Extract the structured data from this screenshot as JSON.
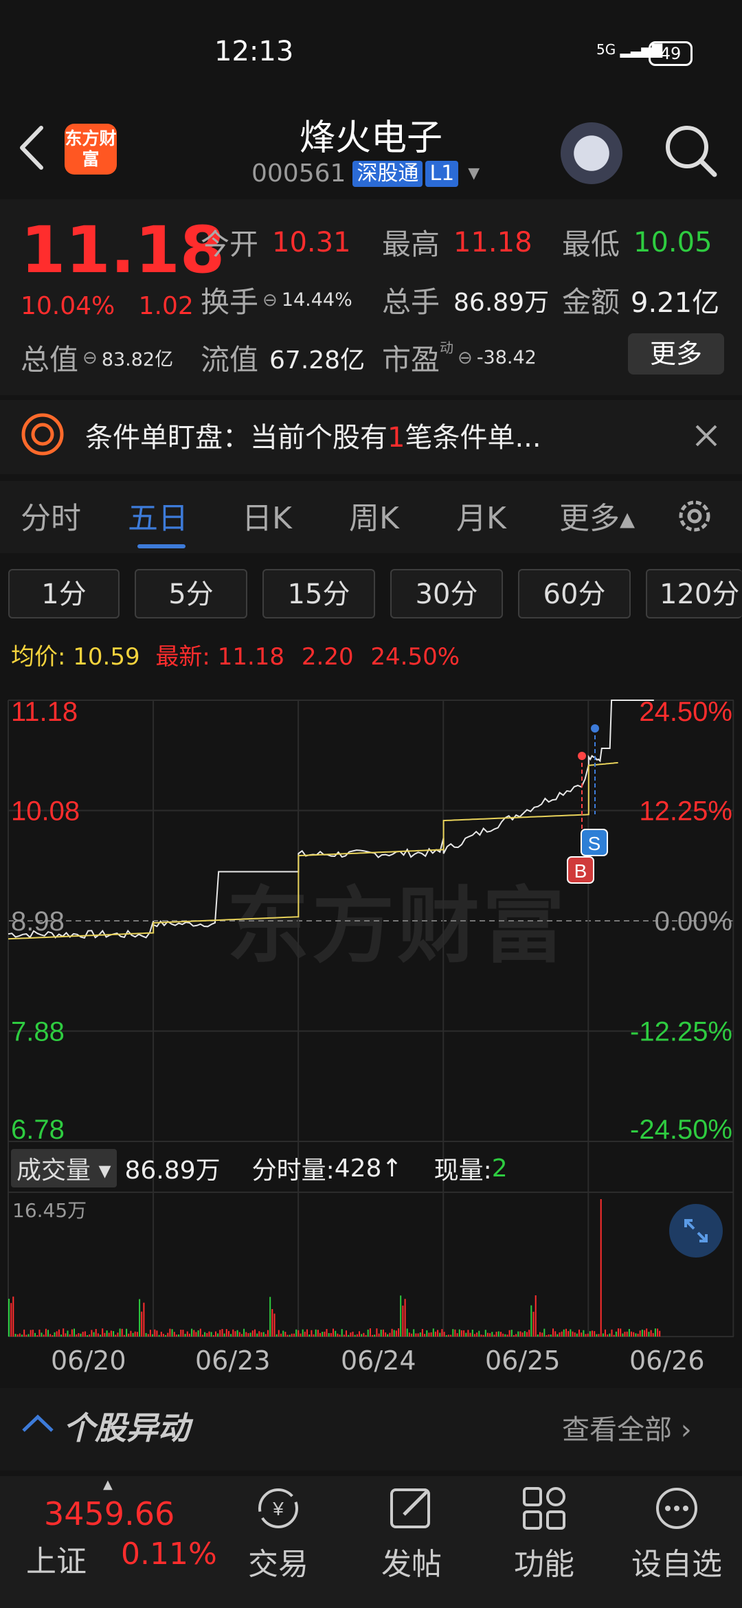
{
  "status": {
    "time": "12:13",
    "signal": "5G",
    "battery": "49"
  },
  "header": {
    "logo_text": "东方财富",
    "stock_name": "烽火电子",
    "code": "000561",
    "tag1": "深股通",
    "tag2": "L1"
  },
  "quote": {
    "price": "11.18",
    "change_pct": "10.04%",
    "change_amt": "1.02",
    "open_label": "今开",
    "open": "10.31",
    "high_label": "最高",
    "high": "11.18",
    "low_label": "最低",
    "low": "10.05",
    "turnover_label": "换手",
    "turnover": "14.44%",
    "volume_label": "总手",
    "volume": "86.89万",
    "amount_label": "金额",
    "amount": "9.21亿",
    "mktcap_label": "总值",
    "mktcap": "83.82亿",
    "float_label": "流值",
    "float": "67.28亿",
    "pe_label": "市盈",
    "pe_sup": "动",
    "pe": "-38.42",
    "more": "更多"
  },
  "alert": {
    "prefix": "条件单盯盘：当前个股有",
    "count": "1",
    "suffix": "笔条件单..."
  },
  "tabs": [
    "分时",
    "五日",
    "日K",
    "周K",
    "月K",
    "更多▴"
  ],
  "periods": [
    "1分",
    "5分",
    "15分",
    "30分",
    "60分",
    "120分"
  ],
  "avg_row": {
    "avg_label": "均价:",
    "avg": "10.59",
    "latest_label": "最新:",
    "latest": "11.18",
    "chg": "2.20",
    "pct": "24.50%"
  },
  "chart": {
    "left_ticks": [
      "11.18",
      "10.08",
      "8.98",
      "7.88",
      "6.78"
    ],
    "right_ticks": [
      "24.50%",
      "12.25%",
      "0.00%",
      "-12.25%",
      "-24.50%"
    ],
    "watermark": "东方财富",
    "marker_s": "S",
    "marker_b": "B"
  },
  "volume": {
    "tag": "成交量",
    "total": "86.89万",
    "minute_label": "分时量:",
    "minute": "428",
    "arrow": "↑",
    "now_label": "现量:",
    "now": "2",
    "max": "16.45万"
  },
  "dates": [
    "06/20",
    "06/23",
    "06/24",
    "06/25",
    "06/26"
  ],
  "anomaly": {
    "title": "个股异动",
    "see_all": "查看全部"
  },
  "bottom": {
    "index_value": "3459.66",
    "index_name": "上证",
    "index_pct": "0.11%",
    "nav": [
      "交易",
      "发帖",
      "功能",
      "设自选"
    ]
  },
  "chart_data": {
    "type": "line",
    "x": [
      "06/20",
      "06/23",
      "06/24",
      "06/25",
      "06/26"
    ],
    "series": [
      {
        "name": "price",
        "values": [
          8.84,
          9.47,
          9.66,
          10.39,
          11.18
        ]
      },
      {
        "name": "均价",
        "values": [
          8.8,
          9.02,
          9.69,
          10.04,
          10.59
        ]
      }
    ],
    "ylim": [
      6.78,
      11.18
    ],
    "right_axis": [
      "24.50%",
      "12.25%",
      "0.00%",
      "-12.25%",
      "-24.50%"
    ],
    "grid": true
  }
}
